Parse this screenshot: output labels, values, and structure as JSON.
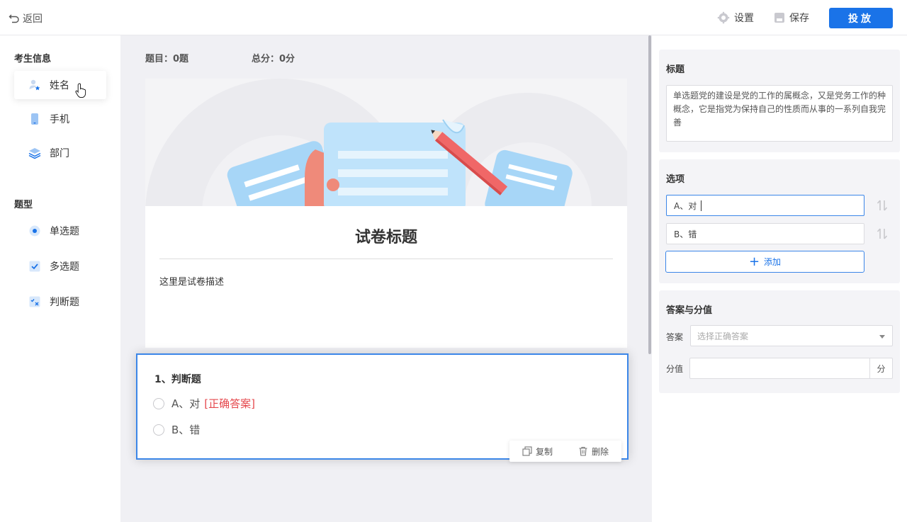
{
  "topbar": {
    "back_label": "返回",
    "settings_label": "设置",
    "save_label": "保存",
    "publish_label": "投放"
  },
  "sidebar": {
    "candidate_section": "考生信息",
    "candidate_items": [
      {
        "label": "姓名",
        "icon": "user-star-icon"
      },
      {
        "label": "手机",
        "icon": "phone-icon"
      },
      {
        "label": "部门",
        "icon": "layers-icon"
      }
    ],
    "type_section": "题型",
    "type_items": [
      {
        "label": "单选题",
        "icon": "radio-icon"
      },
      {
        "label": "多选题",
        "icon": "checkbox-icon"
      },
      {
        "label": "判断题",
        "icon": "judge-icon"
      }
    ]
  },
  "summary": {
    "question_count": "题目：0题",
    "total_score": "总分：0分"
  },
  "paper": {
    "title": "试卷标题",
    "description": "这里是试卷描述"
  },
  "question": {
    "title": "1、判断题",
    "options": [
      {
        "label": "A、对",
        "tag": "[正确答案]"
      },
      {
        "label": "B、错",
        "tag": ""
      }
    ],
    "copy_label": "复制",
    "delete_label": "删除"
  },
  "panel": {
    "title_section": "标题",
    "title_text": "单选题党的建设是党的工作的属概念，又是党务工作的种概念，它是指党为保持自己的性质而从事的一系列自我完善",
    "options_section": "选项",
    "option_values": [
      "A、对",
      "B、错"
    ],
    "add_label": "添加",
    "answer_section": "答案与分值",
    "answer_label": "答案",
    "answer_placeholder": "选择正确答案",
    "score_label": "分值",
    "score_unit": "分"
  },
  "colors": {
    "accent": "#1a73e8",
    "correct": "#e5484d",
    "canvas_bg": "#f0f0f4"
  }
}
